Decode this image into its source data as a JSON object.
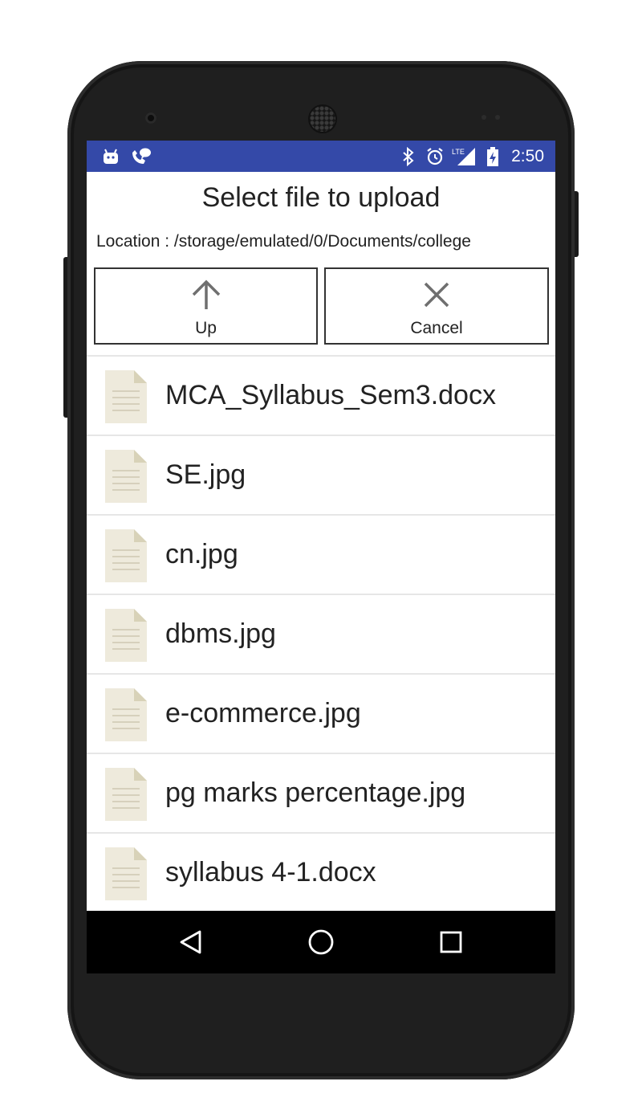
{
  "status_bar": {
    "time": "2:50",
    "left_icons": [
      "android-debug-icon",
      "wifi-call-icon"
    ],
    "right_icons": [
      "bluetooth-icon",
      "alarm-icon",
      "lte-signal-icon",
      "battery-charging-icon"
    ],
    "lte_label": "LTE",
    "background": "#3449a8"
  },
  "dialog": {
    "title": "Select file to upload",
    "location": "Location : /storage/emulated/0/Documents/college",
    "up_button": {
      "label": "Up",
      "icon": "arrow-up-icon"
    },
    "cancel_button": {
      "label": "Cancel",
      "icon": "close-icon"
    }
  },
  "files": [
    {
      "name": "MCA_Syllabus_Sem3.docx",
      "icon": "document-icon"
    },
    {
      "name": "SE.jpg",
      "icon": "document-icon"
    },
    {
      "name": "cn.jpg",
      "icon": "document-icon"
    },
    {
      "name": "dbms.jpg",
      "icon": "document-icon"
    },
    {
      "name": "e-commerce.jpg",
      "icon": "document-icon"
    },
    {
      "name": "pg marks percentage.jpg",
      "icon": "document-icon"
    },
    {
      "name": "syllabus 4-1.docx",
      "icon": "document-icon"
    }
  ],
  "nav_bar": {
    "buttons": [
      "back-icon",
      "home-icon",
      "recents-icon"
    ]
  }
}
